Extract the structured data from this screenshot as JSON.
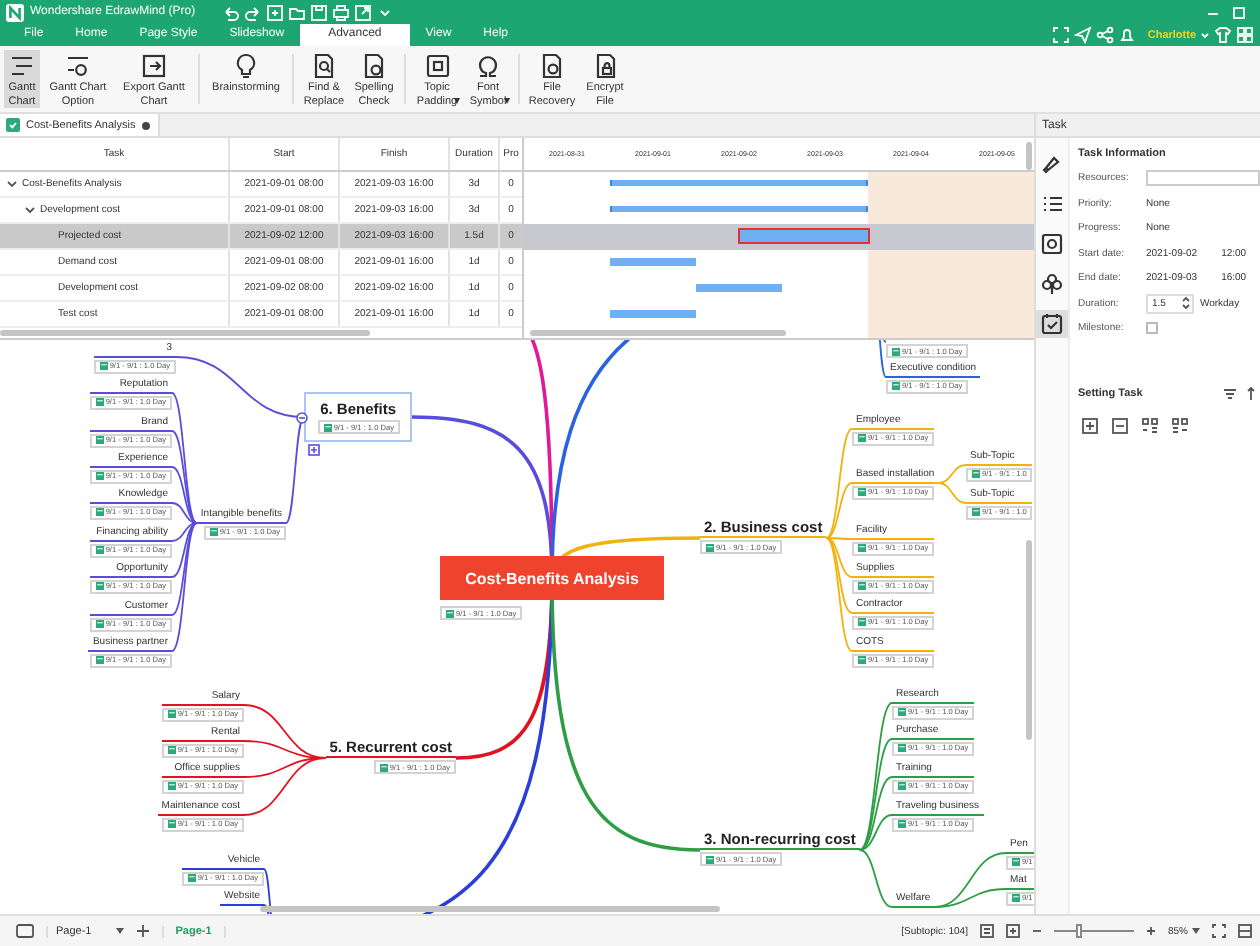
{
  "window": {
    "title": "Wondershare EdrawMind (Pro)"
  },
  "menu_tabs": [
    {
      "label": "File",
      "selected": false
    },
    {
      "label": "Home",
      "selected": false
    },
    {
      "label": "Page Style",
      "selected": false
    },
    {
      "label": "Slideshow",
      "selected": false
    },
    {
      "label": "Advanced",
      "selected": true
    },
    {
      "label": "View",
      "selected": false
    },
    {
      "label": "Help",
      "selected": false
    }
  ],
  "user": {
    "name": "Charlotte"
  },
  "ribbon_groups": [
    [
      {
        "label": "Gantt Chart",
        "kind": "gantt",
        "selected": true
      },
      {
        "label": "Gantt Chart Option",
        "kind": "gantt_option",
        "selected": false
      },
      {
        "label": "Export Gantt Chart",
        "kind": "export",
        "selected": false
      }
    ],
    [
      {
        "label": "Brainstorming",
        "kind": "bulb",
        "selected": false
      }
    ],
    [
      {
        "label": "Find & Replace",
        "kind": "find",
        "selected": false
      },
      {
        "label": "Spelling Check",
        "kind": "spelling",
        "selected": false
      }
    ],
    [
      {
        "label": "Topic Padding",
        "kind": "padding",
        "selected": false,
        "has_menu": true
      },
      {
        "label": "Font Symbol",
        "kind": "symbol",
        "selected": false,
        "has_menu": true
      }
    ],
    [
      {
        "label": "File Recovery",
        "kind": "recovery",
        "selected": false
      },
      {
        "label": "Encrypt File",
        "kind": "encrypt",
        "selected": false
      }
    ]
  ],
  "doc_tabs": [
    {
      "label": "Cost-Benefits Analysis",
      "selected": true,
      "unsaved": true
    }
  ],
  "gantt": {
    "columns": [
      "Task",
      "Start",
      "Finish",
      "Duration",
      "Pro"
    ],
    "dates": [
      {
        "label": "2021-08-31",
        "weekend": false
      },
      {
        "label": "2021-09-01",
        "weekend": false
      },
      {
        "label": "2021-09-02",
        "weekend": false
      },
      {
        "label": "2021-09-03",
        "weekend": false
      },
      {
        "label": "2021-09-04",
        "weekend": true
      },
      {
        "label": "2021-09-05",
        "weekend": true
      }
    ],
    "rows": [
      {
        "task": "Cost-Benefits Analysis",
        "start": "2021-09-01 08:00",
        "finish": "2021-09-03 16:00",
        "duration": "3d",
        "progress": "0",
        "expanded": true,
        "selected": false,
        "children": [
          {
            "task": "Development cost",
            "start": "2021-09-01 08:00",
            "finish": "2021-09-03 16:00",
            "duration": "3d",
            "progress": "0",
            "expanded": true,
            "selected": false,
            "children": [
              {
                "task": "Projected cost",
                "start": "2021-09-02 12:00",
                "finish": "2021-09-03 16:00",
                "duration": "1.5d",
                "progress": "0",
                "selected": true
              },
              {
                "task": "Demand cost",
                "start": "2021-09-01 08:00",
                "finish": "2021-09-01 16:00",
                "duration": "1d",
                "progress": "0",
                "selected": false
              },
              {
                "task": "Development cost",
                "start": "2021-09-02 08:00",
                "finish": "2021-09-02 16:00",
                "duration": "1d",
                "progress": "0",
                "selected": false
              },
              {
                "task": "Test cost",
                "start": "2021-09-01 08:00",
                "finish": "2021-09-01 16:00",
                "duration": "1d",
                "progress": "0",
                "selected": false
              }
            ]
          }
        ]
      }
    ]
  },
  "mind_map": {
    "central": {
      "label": "Cost-Benefits Analysis",
      "date": "9/1 - 9/1 : 1.0 Day"
    },
    "branches": [
      {
        "label": "6. Benefits",
        "date": "9/1 - 9/1 : 1.0 Day",
        "color": "#5a4ddb",
        "selected": true,
        "children": [
          {
            "label": "3",
            "date": "9/1 - 9/1 : 1.0 Day"
          },
          {
            "label": "Intangible benefits",
            "date": "9/1 - 9/1 : 1.0 Day",
            "children": [
              {
                "label": "Reputation",
                "date": "9/1 - 9/1 : 1.0 Day"
              },
              {
                "label": "Brand",
                "date": "9/1 - 9/1 : 1.0 Day"
              },
              {
                "label": "Experience",
                "date": "9/1 - 9/1 : 1.0 Day"
              },
              {
                "label": "Knowledge",
                "date": "9/1 - 9/1 : 1.0 Day"
              },
              {
                "label": "Financing ability",
                "date": "9/1 - 9/1 : 1.0 Day"
              },
              {
                "label": "Opportunity",
                "date": "9/1 - 9/1 : 1.0 Day"
              },
              {
                "label": "Customer",
                "date": "9/1 - 9/1 : 1.0 Day"
              },
              {
                "label": "Business partner",
                "date": "9/1 - 9/1 : 1.0 Day"
              }
            ]
          }
        ]
      },
      {
        "label": "5. Recurrent cost",
        "date": "9/1 - 9/1 : 1.0 Day",
        "color": "#e01420",
        "selected": false,
        "children": [
          {
            "label": "Salary",
            "date": "9/1 - 9/1 : 1.0 Day"
          },
          {
            "label": "Rental",
            "date": "9/1 - 9/1 : 1.0 Day"
          },
          {
            "label": "Office supplies",
            "date": "9/1 - 9/1 : 1.0 Day"
          },
          {
            "label": "Maintenance cost",
            "date": "9/1 - 9/1 : 1.0 Day"
          }
        ]
      },
      {
        "color": "#2c3ed8",
        "children": [
          {
            "label": "Vehicle",
            "date": "9/1 - 9/1 : 1.0 Day"
          },
          {
            "label": "Website"
          }
        ]
      },
      {
        "color": "#e0189a"
      },
      {
        "color": "#2a63e0",
        "children": [
          {
            "date": "9/1 - 9/1 : 1.0 Day"
          },
          {
            "label": "Executive condition",
            "date": "9/1 - 9/1 : 1.0 Day"
          }
        ]
      },
      {
        "label": "2. Business cost",
        "date": "9/1 - 9/1 : 1.0 Day",
        "color": "#f2b10c",
        "selected": false,
        "children": [
          {
            "label": "Employee",
            "date": "9/1 - 9/1 : 1.0 Day"
          },
          {
            "label": "Based installation",
            "date": "9/1 - 9/1 : 1.0 Day",
            "children": [
              {
                "label": "Sub-Topic",
                "date": "9/1 - 9/1 : 1.0"
              },
              {
                "label": "Sub-Topic",
                "date": "9/1 - 9/1 : 1.0"
              }
            ]
          },
          {
            "label": "Facility",
            "date": "9/1 - 9/1 : 1.0 Day"
          },
          {
            "label": "Supplies",
            "date": "9/1 - 9/1 : 1.0 Day"
          },
          {
            "label": "Contractor",
            "date": "9/1 - 9/1 : 1.0 Day"
          },
          {
            "label": "COTS",
            "date": "9/1 - 9/1 : 1.0 Day"
          }
        ]
      },
      {
        "label": "3. Non-recurring cost",
        "date": "9/1 - 9/1 : 1.0 Day",
        "color": "#2e9e44",
        "selected": false,
        "children": [
          {
            "label": "Research",
            "date": "9/1 - 9/1 : 1.0 Day"
          },
          {
            "label": "Purchase",
            "date": "9/1 - 9/1 : 1.0 Day"
          },
          {
            "label": "Training",
            "date": "9/1 - 9/1 : 1.0 Day"
          },
          {
            "label": "Traveling business",
            "date": "9/1 - 9/1 : 1.0 Day"
          },
          {
            "label": "Welfare",
            "children": [
              {
                "label": "Pen",
                "date": "9/1"
              },
              {
                "label": "Mat",
                "date": "9/1"
              }
            ]
          }
        ]
      }
    ]
  },
  "task_panel": {
    "title": "Task",
    "section": "Task Information",
    "side_icons": [
      {
        "kind": "brush",
        "selected": false
      },
      {
        "kind": "list",
        "selected": false
      },
      {
        "kind": "frame",
        "selected": false
      },
      {
        "kind": "clover",
        "selected": false
      },
      {
        "kind": "task",
        "selected": true
      }
    ],
    "fields": [
      {
        "label": "Resources:",
        "kind": "input"
      },
      {
        "label": "Priority:",
        "kind": "text",
        "value": "None"
      },
      {
        "label": "Progress:",
        "kind": "text",
        "value": "None"
      },
      {
        "label": "Start date:",
        "kind": "datetime",
        "date": "2021-09-02",
        "time": "12:00"
      },
      {
        "label": "End date:",
        "kind": "datetime",
        "date": "2021-09-03",
        "time": "16:00"
      },
      {
        "label": "Duration:",
        "kind": "spinner",
        "value": "1.5",
        "unit": "Workday"
      },
      {
        "label": "Milestone:",
        "kind": "checkbox",
        "checked": false
      }
    ],
    "setting_title": "Setting Task"
  },
  "status_bar": {
    "page_select": "Page-1",
    "page_tabs": [
      {
        "label": "Page-1",
        "selected": true
      }
    ],
    "count": "[Subtopic: 104]",
    "zoom": {
      "value": "85%",
      "level": 0.3
    }
  }
}
